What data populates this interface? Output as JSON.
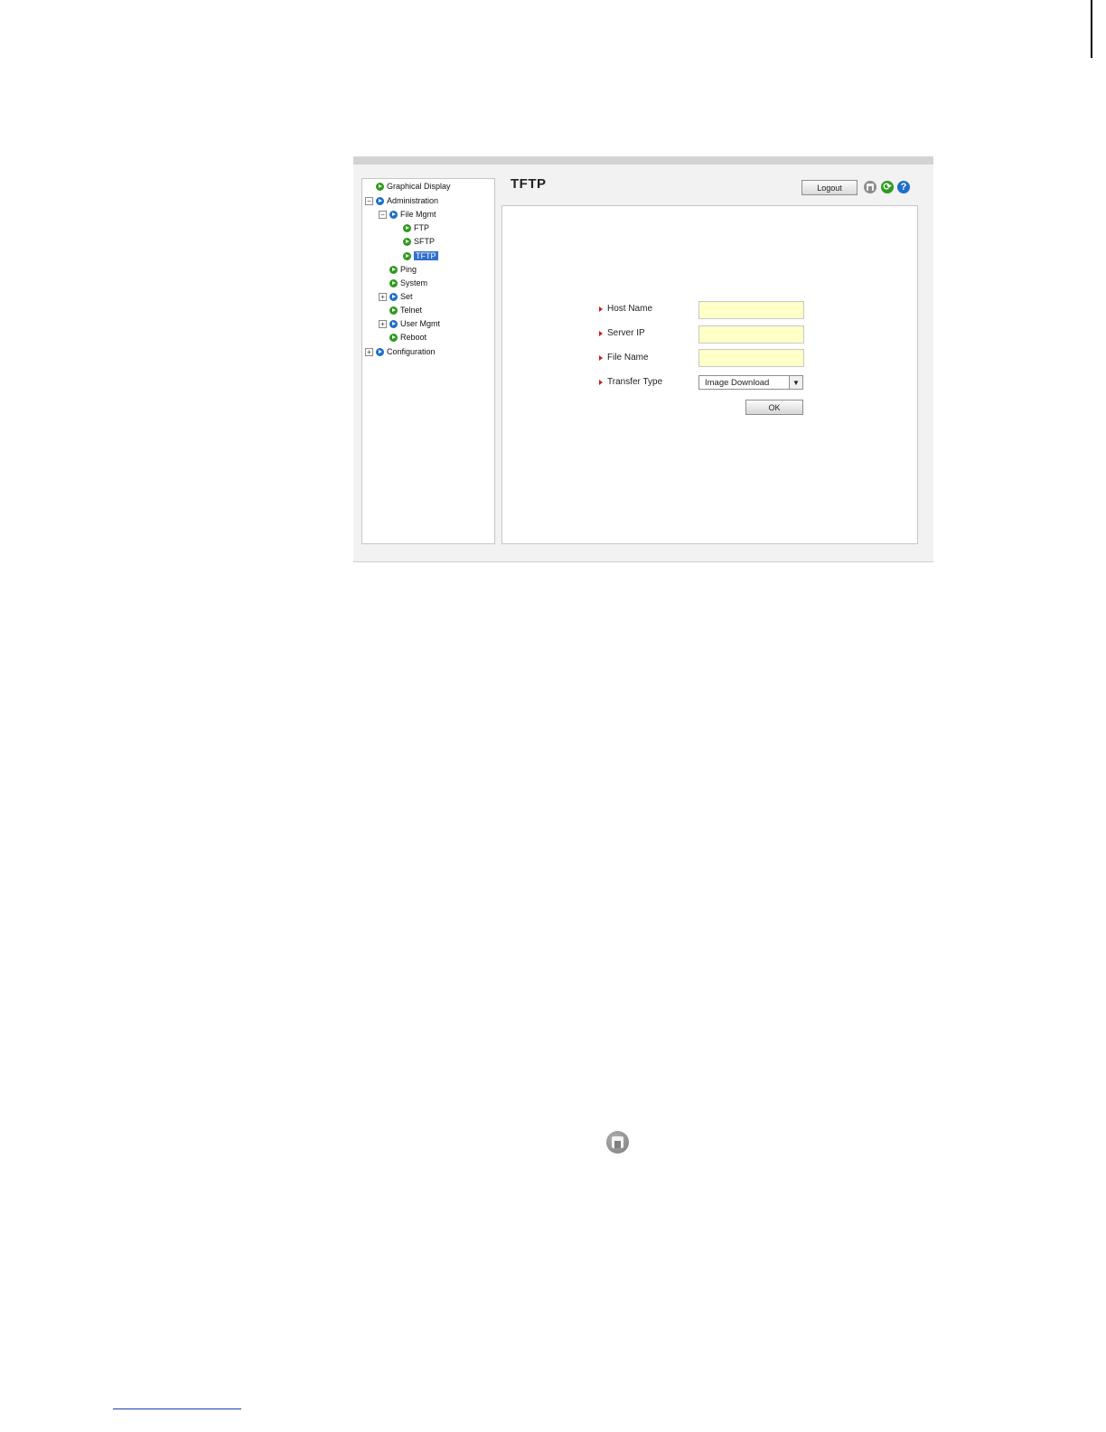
{
  "tree": {
    "items": [
      {
        "label": "Graphical Display"
      },
      {
        "label": "Administration"
      },
      {
        "label": "File Mgmt"
      },
      {
        "label": "FTP"
      },
      {
        "label": "SFTP"
      },
      {
        "label": "TFTP"
      },
      {
        "label": "Ping"
      },
      {
        "label": "System"
      },
      {
        "label": "Set"
      },
      {
        "label": "Telnet"
      },
      {
        "label": "User Mgmt"
      },
      {
        "label": "Reboot"
      },
      {
        "label": "Configuration"
      }
    ],
    "selected": "TFTP",
    "expand_symbol": "+",
    "collapse_symbol": "−"
  },
  "header": {
    "title": "TFTP",
    "logout_label": "Logout",
    "refresh_glyph": "⟳",
    "help_glyph": "?"
  },
  "form": {
    "host_name_label": "Host Name",
    "host_name_value": "",
    "server_ip_label": "Server IP",
    "server_ip_value": "",
    "file_name_label": "File Name",
    "file_name_value": "",
    "transfer_type_label": "Transfer Type",
    "transfer_type_value": "Image Download",
    "select_arrow_glyph": "▼",
    "ok_label": "OK"
  },
  "colors": {
    "selected_bg": "#2f6fd1",
    "input_bg": "#ffffc8",
    "label_arrow": "#c8201f",
    "bullet_green": "#2e9a1f",
    "bullet_blue": "#1f6fc9"
  }
}
